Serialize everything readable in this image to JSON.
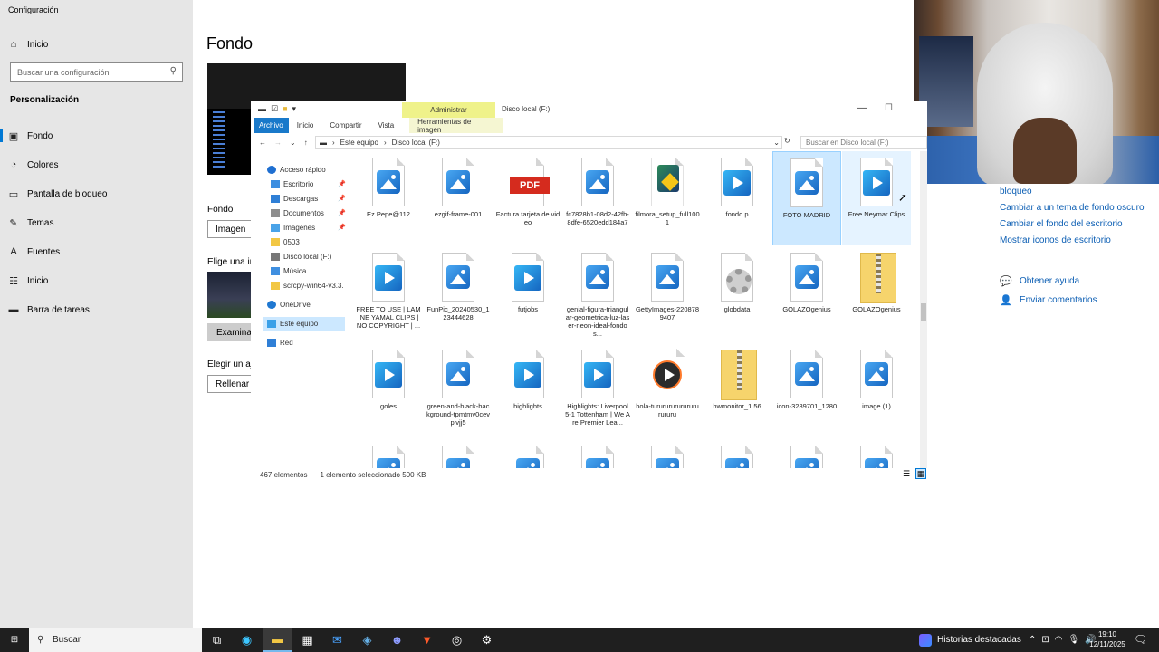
{
  "settings": {
    "app_title": "Configuración",
    "home": "Inicio",
    "search_placeholder": "Buscar una configuración",
    "section": "Personalización",
    "nav": [
      "Fondo",
      "Colores",
      "Pantalla de bloqueo",
      "Temas",
      "Fuentes",
      "Inicio",
      "Barra de tareas"
    ],
    "page_title": "Fondo",
    "bg_label": "Fondo",
    "bg_value": "Imagen",
    "choose_label": "Elige una im",
    "browse": "Examinar",
    "fit_label": "Elegir un aj",
    "fit_value": "Rellenar",
    "related_links": [
      "bloqueo",
      "Cambiar a un tema de fondo oscuro",
      "Cambiar el fondo del escritorio",
      "Mostrar iconos de escritorio"
    ],
    "help": "Obtener ayuda",
    "feedback": "Enviar comentarios"
  },
  "explorer": {
    "context_tab": "Administrar",
    "title": "Disco local (F:)",
    "tabs": [
      "Archivo",
      "Inicio",
      "Compartir",
      "Vista"
    ],
    "tools_tab": "Herramientas de imagen",
    "breadcrumb": [
      "Este equipo",
      "Disco local (F:)"
    ],
    "search_placeholder": "Buscar en Disco local (F:)",
    "nav": [
      {
        "label": "Acceso rápido",
        "icon": "star-icon"
      },
      {
        "label": "Escritorio",
        "icon": "desktop-folder-icon",
        "pinned": true
      },
      {
        "label": "Descargas",
        "icon": "download-folder-icon",
        "pinned": true
      },
      {
        "label": "Documentos",
        "icon": "documents-folder-icon",
        "pinned": true
      },
      {
        "label": "Imágenes",
        "icon": "pictures-folder-icon",
        "pinned": true
      },
      {
        "label": "0503",
        "icon": "folder-icon"
      },
      {
        "label": "Disco local (F:)",
        "icon": "drive-icon"
      },
      {
        "label": "Música",
        "icon": "music-folder-icon"
      },
      {
        "label": "scrcpy-win64-v3.3.",
        "icon": "folder-icon"
      },
      {
        "label": "OneDrive",
        "icon": "onedrive-icon"
      },
      {
        "label": "Este equipo",
        "icon": "computer-icon"
      },
      {
        "label": "Red",
        "icon": "network-icon"
      }
    ],
    "files": [
      {
        "name": "Ez Pepe@112",
        "type": "pic"
      },
      {
        "name": "ezgif-frame-001",
        "type": "pic"
      },
      {
        "name": "Factura tarjeta de video",
        "type": "pdf"
      },
      {
        "name": "fc7828b1-08d2-42fb-8dfe-6520edd184a7",
        "type": "pic"
      },
      {
        "name": "filmora_setup_full1001",
        "type": "setup"
      },
      {
        "name": "fondo p",
        "type": "vid"
      },
      {
        "name": "FOTO MADRID",
        "type": "pic",
        "selected": true
      },
      {
        "name": "Free Neymar Clips",
        "type": "vid",
        "hover": true
      },
      {
        "name": "FREE TO USE | LAMINE YAMAL CLIPS | NO COPYRIGHT | ...",
        "type": "vid"
      },
      {
        "name": "FunPic_20240530_123444628",
        "type": "pic"
      },
      {
        "name": "futjobs",
        "type": "vid"
      },
      {
        "name": "genial-figura-triangular-geometrica-luz-laser-neon-ideal-fondos...",
        "type": "pic"
      },
      {
        "name": "GettyImages-2208789407",
        "type": "pic"
      },
      {
        "name": "globdata",
        "type": "gear"
      },
      {
        "name": "GOLAZOgenius",
        "type": "pic"
      },
      {
        "name": "GOLAZOgenius",
        "type": "zip"
      },
      {
        "name": "goles",
        "type": "vid"
      },
      {
        "name": "green-and-black-background-tpmtmv0cevpivjj5",
        "type": "pic"
      },
      {
        "name": "highlights",
        "type": "vid"
      },
      {
        "name": "Highlights: Liverpool 5-1 Tottenham | We Are Premier Lea...",
        "type": "vid"
      },
      {
        "name": "hola-tururururururururururu",
        "type": "media"
      },
      {
        "name": "hwmonitor_1.56",
        "type": "zip"
      },
      {
        "name": "icon-3289701_1280",
        "type": "pic"
      },
      {
        "name": "image (1)",
        "type": "pic"
      },
      {
        "name": "",
        "type": "pic"
      },
      {
        "name": "",
        "type": "pic"
      },
      {
        "name": "",
        "type": "pic"
      },
      {
        "name": "",
        "type": "pic"
      },
      {
        "name": "",
        "type": "pic"
      },
      {
        "name": "",
        "type": "pic"
      },
      {
        "name": "",
        "type": "pic"
      },
      {
        "name": "",
        "type": "pic"
      }
    ],
    "status_count": "467 elementos",
    "status_selected": "1 elemento seleccionado  500 KB"
  },
  "taskbar": {
    "search": "Buscar",
    "news": "Historias destacadas",
    "time": "19:10",
    "date": "12/11/2025",
    "apps": [
      "task-view-icon",
      "edge-icon",
      "file-explorer-icon",
      "store-icon",
      "outlook-icon",
      "steam-icon",
      "discord-icon",
      "brave-icon",
      "obs-icon",
      "settings-icon"
    ]
  },
  "colors": {
    "accent": "#0078d4",
    "selection": "#cce8ff",
    "ribbon_context": "#eff28a"
  }
}
